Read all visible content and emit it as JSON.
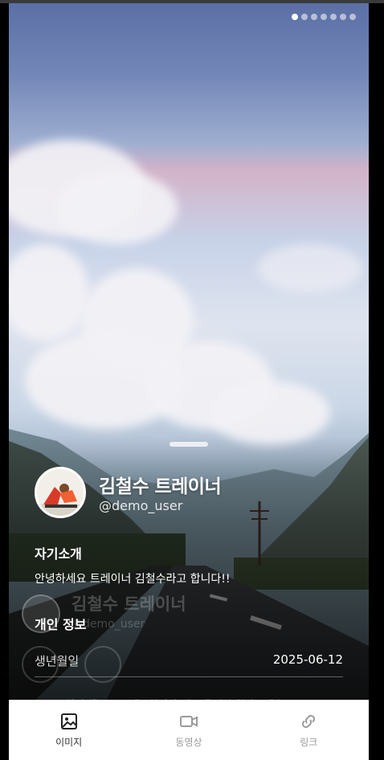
{
  "carousel": {
    "total": 7,
    "active_index": 0
  },
  "profile": {
    "name": "김철수 트레이너",
    "handle": "@demo_user",
    "avatar_icon": "trainer-photo"
  },
  "intro": {
    "title": "자기소개",
    "text": "안녕하세요 트레이너 김철수라고 합니다!!"
  },
  "personal_info": {
    "title": "개인 정보",
    "rows": [
      {
        "label": "생년월일",
        "value": "2025-06-12"
      }
    ]
  },
  "ghost": {
    "name": "김철수 트레이너",
    "handle": "@demo_user",
    "line": "와의 채드로 트레프찾지나 이로 금이나 찾아보세요"
  },
  "tabs": [
    {
      "label": "이미지",
      "icon": "image-icon",
      "active": true
    },
    {
      "label": "동영상",
      "icon": "video-icon",
      "active": false
    },
    {
      "label": "링크",
      "icon": "link-icon",
      "active": false
    }
  ],
  "colors": {
    "active_tab": "#333333",
    "inactive_tab": "#9a9a9a",
    "background": "#000000"
  }
}
